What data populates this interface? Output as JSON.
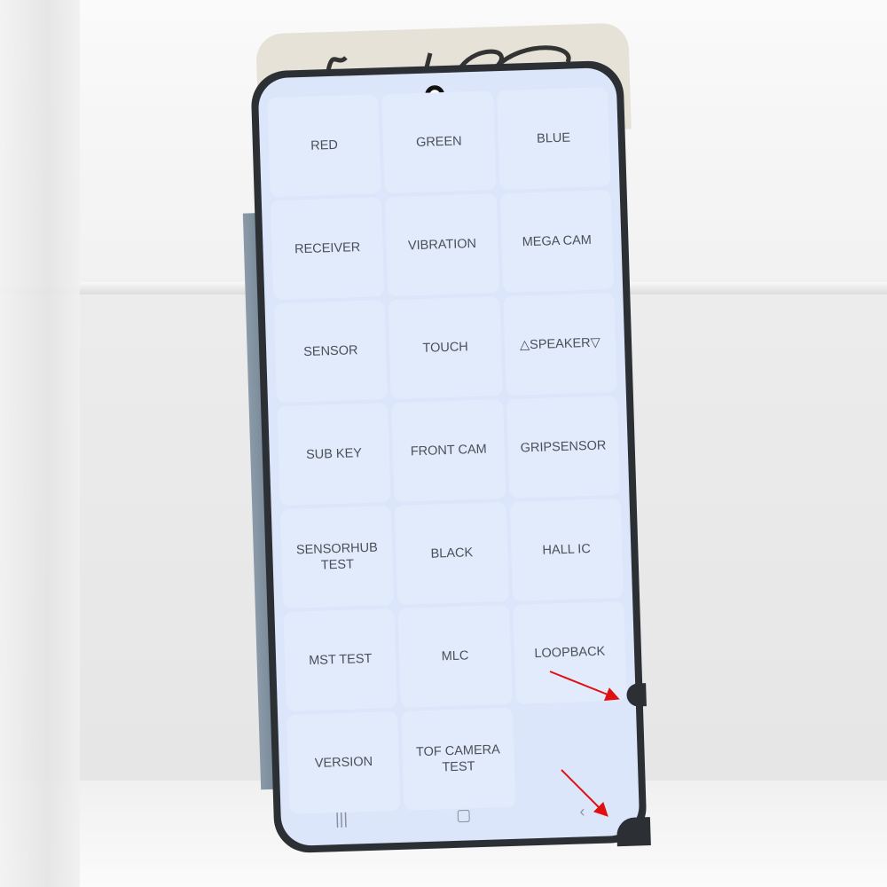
{
  "tiles": [
    {
      "label": "RED"
    },
    {
      "label": "GREEN"
    },
    {
      "label": "BLUE"
    },
    {
      "label": "RECEIVER"
    },
    {
      "label": "VIBRATION"
    },
    {
      "label": "MEGA CAM"
    },
    {
      "label": "SENSOR"
    },
    {
      "label": "TOUCH"
    },
    {
      "label": "△SPEAKER▽"
    },
    {
      "label": "SUB KEY"
    },
    {
      "label": "FRONT CAM"
    },
    {
      "label": "GRIPSENSOR"
    },
    {
      "label": "SENSORHUB TEST"
    },
    {
      "label": "BLACK"
    },
    {
      "label": "HALL IC"
    },
    {
      "label": "MST TEST"
    },
    {
      "label": "MLC"
    },
    {
      "label": "LOOPBACK"
    },
    {
      "label": "VERSION"
    },
    {
      "label": "TOF CAMERA TEST"
    },
    {
      "label": ""
    }
  ],
  "nav": {
    "recents": "|||",
    "home": "▢",
    "back": "‹"
  },
  "colors": {
    "screen": "#dbe6fb",
    "tile": "#e2ebfb",
    "bezel": "#2c3034",
    "arrow": "#e01010"
  },
  "icons": {
    "camera": "front-camera-hole",
    "arrows": "red-arrow"
  }
}
